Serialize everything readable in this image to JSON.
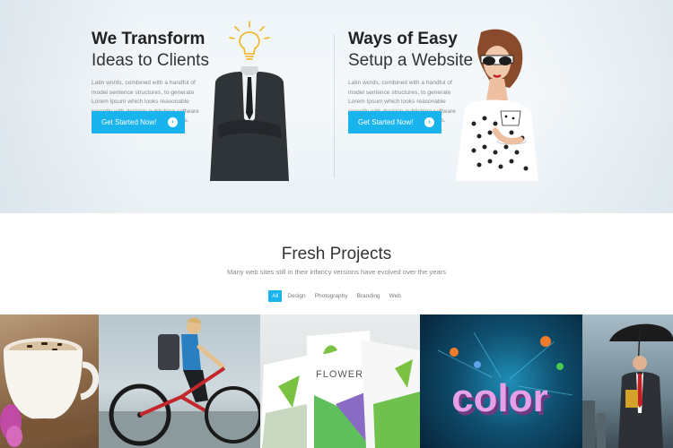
{
  "hero": {
    "left": {
      "title_bold": "We Transform",
      "title_light": "Ideas to Clients",
      "text": "Latin words, combined with a handful of model sentence structures, to generate Lorem Ipsum which looks reasonable recently with desktop publishing software like into including versions passages.",
      "cta_label": "Get Started Now!"
    },
    "right": {
      "title_bold": "Ways of Easy",
      "title_light": "Setup a Website",
      "text": "Latin words, combined with a handful of model sentence structures, to generate Lorem Ipsum which looks reasonable recently with desktop publishing software like into including versions passages.",
      "cta_label": "Get Started Now!"
    },
    "cta_icon": "arrow-right-circle-icon"
  },
  "projects": {
    "title": "Fresh Projects",
    "subtitle": "Many web sites still in their infancy versions have evolved over the years",
    "filters": [
      {
        "label": "All",
        "active": true
      },
      {
        "label": "Design",
        "active": false
      },
      {
        "label": "Photography",
        "active": false
      },
      {
        "label": "Branding",
        "active": false
      },
      {
        "label": "Web",
        "active": false
      }
    ],
    "tiles": [
      {
        "subject": "coffee-cup"
      },
      {
        "subject": "cyclist"
      },
      {
        "subject": "flower-packaging",
        "brand_text": "FLOWER"
      },
      {
        "subject": "color-3d-text",
        "art_text": "color"
      },
      {
        "subject": "businessman-umbrella"
      }
    ]
  },
  "colors": {
    "accent": "#19b4ee",
    "heading": "#222222",
    "body_text": "#888888"
  }
}
